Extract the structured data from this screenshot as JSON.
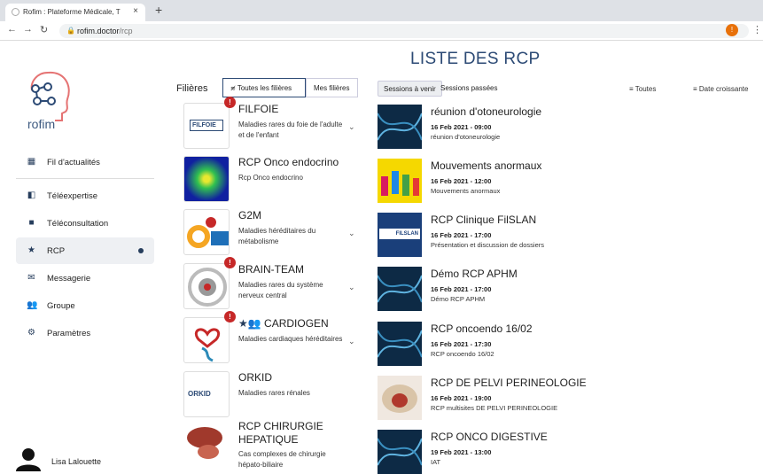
{
  "browser": {
    "tab_title": "Rofim : Plateforme Médicale, T",
    "url_domain": "rofim.doctor",
    "url_path": "/rcp",
    "profile_letter": "!"
  },
  "logo": {
    "text": "rofim"
  },
  "sidebar": {
    "items": [
      {
        "label": "Fil d'actualités",
        "icon": "dashboard-icon"
      },
      {
        "label": "Téléexpertise",
        "icon": "library-icon"
      },
      {
        "label": "Téléconsultation",
        "icon": "video-camera-icon"
      },
      {
        "label": "RCP",
        "icon": "star-icon"
      },
      {
        "label": "Messagerie",
        "icon": "mail-icon"
      },
      {
        "label": "Groupe",
        "icon": "people-icon"
      },
      {
        "label": "Paramètres",
        "icon": "gear-icon"
      }
    ],
    "user_name": "Lisa Lalouette"
  },
  "page": {
    "title": "LISTE DES RCP"
  },
  "filieres": {
    "label": "Filières",
    "all_label": "Toutes les filières",
    "mine_label": "Mes filières",
    "items": [
      {
        "name": "FILFOIE",
        "desc": "Maladies rares du foie de l'adulte et de l'enfant",
        "badge": "!",
        "thumb_text": "FILFOIE"
      },
      {
        "name": "RCP Onco endocrino",
        "desc": "Rcp Onco endocrino",
        "badge": ""
      },
      {
        "name": "G2M",
        "desc": "Maladies héréditaires du métabolisme",
        "badge": ""
      },
      {
        "name": "BRAIN-TEAM",
        "desc": "Maladies rares du système nerveux central",
        "badge": "!"
      },
      {
        "name": "CARDIOGEN",
        "desc": "Maladies cardiaques héréditaires",
        "badge": "!",
        "prefix": "★👥"
      },
      {
        "name": "ORKID",
        "desc": "Maladies rares rénales",
        "badge": "",
        "thumb_text": "ORKID"
      },
      {
        "name": "RCP CHIRURGIE HEPATIQUE",
        "desc": "Cas complexes de chirurgie hépato-biliaire",
        "badge": ""
      }
    ]
  },
  "sessions": {
    "tab_upcoming": "Sessions à venir",
    "tab_past": "Sessions passées",
    "filter_all": "Toutes",
    "sort_label": "Date croissante",
    "items": [
      {
        "title": "réunion d'otoneurologie",
        "date": "16 Feb 2021 - 09:00",
        "sub": "réunion d'otoneurologie"
      },
      {
        "title": "Mouvements anormaux",
        "date": "16 Feb 2021 - 12:00",
        "sub": "Mouvements anormaux"
      },
      {
        "title": "RCP Clinique FilSLAN",
        "date": "16 Feb 2021 - 17:00",
        "sub": "Présentation et discussion de dossiers",
        "thumb_text": "FILSLAN"
      },
      {
        "title": "Démo RCP APHM",
        "date": "16 Feb 2021 - 17:00",
        "sub": "Démo RCP APHM"
      },
      {
        "title": "RCP oncoendo 16/02",
        "date": "16 Feb 2021 - 17:30",
        "sub": "RCP oncoendo 16/02"
      },
      {
        "title": "RCP DE PELVI PERINEOLOGIE",
        "date": "16 Feb 2021 - 19:00",
        "sub": "RCP multisites DE PELVI PERINEOLOGIE"
      },
      {
        "title": "RCP ONCO DIGESTIVE",
        "date": "19 Feb 2021 - 13:00",
        "sub": "IAT"
      }
    ]
  }
}
